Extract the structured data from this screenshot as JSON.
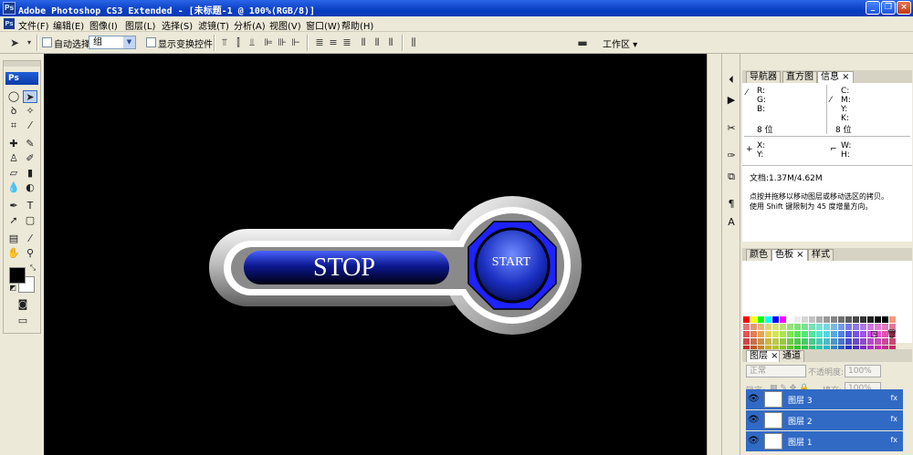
{
  "titlebar": {
    "title": "Adobe Photoshop CS3 Extended - [未标题-1 @ 100%(RGB/8)]",
    "app_icon": "Ps"
  },
  "menu": [
    "文件(F)",
    "编辑(E)",
    "图像(I)",
    "图层(L)",
    "选择(S)",
    "滤镜(T)",
    "分析(A)",
    "视图(V)",
    "窗口(W)",
    "帮助(H)"
  ],
  "options": {
    "auto_select_label": "自动选择:",
    "auto_select_value": "组",
    "show_transform_label": "显示变换控件",
    "workspace_label": "工作区 ▾"
  },
  "toolbox": {
    "logo": "Ps"
  },
  "canvas": {
    "stop_label": "STOP",
    "start_label": "START",
    "accent_blue": "#1d22ff",
    "background": "#000000"
  },
  "info_panel": {
    "tabs": [
      "导航器",
      "直方图",
      "信息 ×"
    ],
    "r": "R:",
    "g": "G:",
    "b": "B:",
    "c": "C:",
    "m": "M:",
    "y": "Y:",
    "k": "K:",
    "bit_left": "8 位",
    "bit_right": "8 位",
    "x": "X:",
    "yy": "Y:",
    "w": "W:",
    "h": "H:",
    "doc": "文档:1.37M/4.62M",
    "hint1": "点按并拖移以移动图层或移动选区的拷贝。",
    "hint2": "使用 Shift 键限制为 45 度增量方向。"
  },
  "swatch_panel": {
    "tabs": [
      "颜色",
      "色板 ×",
      "样式"
    ]
  },
  "layers_panel": {
    "tabs": [
      "图层 ×",
      "通道"
    ],
    "blend_mode": "正常",
    "opacity_label": "不透明度:",
    "opacity_value": "100%",
    "lock_label": "锁定:",
    "fill_label": "填充:",
    "fill_value": "100%",
    "layers": [
      {
        "name": "图层 3",
        "fx": "fx"
      },
      {
        "name": "图层 2",
        "fx": "fx"
      },
      {
        "name": "图层 1",
        "fx": "fx"
      }
    ]
  }
}
